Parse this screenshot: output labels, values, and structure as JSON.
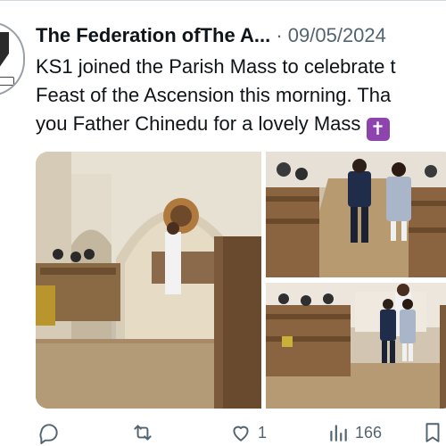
{
  "tweet": {
    "author_name": "The Federation ofThe A...",
    "separator": "·",
    "date": "09/05/2024",
    "text_lines": [
      "KS1 joined the Parish Mass to celebrate t",
      "Feast of the Ascension this morning. Tha",
      "you Father Chinedu for a lovely Mass"
    ],
    "emoji": "✝"
  },
  "actions": {
    "reply_count": "",
    "repost_count": "",
    "like_count": "1",
    "views_count": "166"
  },
  "icons": {
    "reply": "reply-icon",
    "repost": "repost-icon",
    "like": "heart-icon",
    "views": "views-icon",
    "bookmark": "bookmark-icon"
  },
  "colors": {
    "text": "#0f1419",
    "muted": "#536471",
    "emoji_bg": "#8e44ad"
  }
}
